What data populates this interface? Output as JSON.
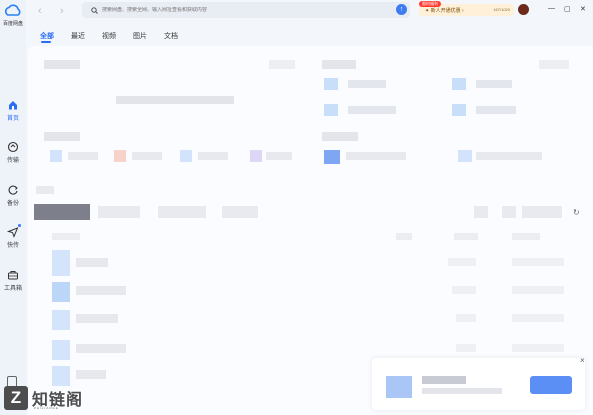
{
  "app": {
    "name": "百度网盘",
    "brand_color": "#2a6cf6"
  },
  "sidebar": {
    "items": [
      {
        "label": "首页",
        "icon": "home-icon",
        "active": true
      },
      {
        "label": "传输",
        "icon": "transfer-icon",
        "active": false
      },
      {
        "label": "备份",
        "icon": "backup-icon",
        "active": false
      },
      {
        "label": "快传",
        "icon": "send-icon",
        "active": false,
        "dot": true
      },
      {
        "label": "工具箱",
        "icon": "toolbox-icon",
        "active": false
      }
    ]
  },
  "topbar": {
    "back": "‹",
    "forward": "›",
    "search_placeholder": "搜索网盘、搜索全网、输入网址查看和获取内容",
    "upload_icon": "upload-icon",
    "vip_badge": "限时福利",
    "vip_text": "新人开通优惠",
    "vip_count": "167/1020",
    "minimize": "—",
    "maximize": "▢",
    "close": "✕"
  },
  "tabs": [
    {
      "label": "全部",
      "active": true
    },
    {
      "label": "最近",
      "active": false
    },
    {
      "label": "视频",
      "active": false
    },
    {
      "label": "图片",
      "active": false
    },
    {
      "label": "文档",
      "active": false
    }
  ],
  "refresh_icon": "↻",
  "toast_close": "×",
  "watermark": {
    "z": "Z",
    "text": "知链阁",
    "sub": "ZHILIANGE"
  }
}
